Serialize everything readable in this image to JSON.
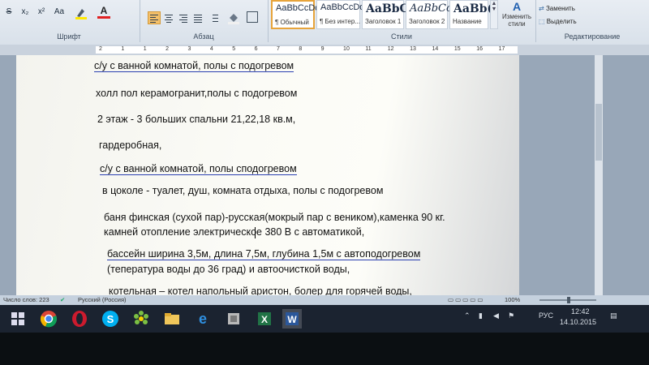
{
  "ribbon": {
    "groups": {
      "font": "Шрифт",
      "paragraph": "Абзац",
      "styles": "Стили",
      "editing": "Редактирование"
    },
    "font_buttons": [
      "S",
      "x₂",
      "x²",
      "Aa",
      "A",
      "A"
    ],
    "styles": [
      {
        "sample": "AaBbCcDd",
        "name": "¶ Обычный"
      },
      {
        "sample": "AaBbCcDd",
        "name": "¶ Без интер..."
      },
      {
        "sample": "AaBbC",
        "name": "Заголовок 1"
      },
      {
        "sample": "AaBbCc",
        "name": "Заголовок 2"
      },
      {
        "sample": "AaBb(",
        "name": "Название"
      }
    ],
    "change_styles_label": "Изменить стили",
    "replace_label": "Заменить",
    "select_label": "Выделить"
  },
  "ruler": {
    "numbers": [
      "2",
      "1",
      "1",
      "2",
      "3",
      "4",
      "5",
      "6",
      "7",
      "8",
      "9",
      "10",
      "11",
      "12",
      "13",
      "14",
      "15",
      "16",
      "17"
    ]
  },
  "document": {
    "lines": [
      "с/у с ванной комнатой, полы с подогревом",
      "холл пол керамогранит,полы  с подогревом",
      "2 этаж - 3 больших спальни 21,22,18 кв.м,",
      "гардеробная,",
      "с/у с ванной комнатой, полы сподогревом",
      "в цоколе - туалет, душ, комната отдыха, полы с подогревом",
      "баня финская  (сухой пар)-русская(мокрый пар с веником),каменка 90 кг.",
      "камней отопление электрическое 380 В с автоматикой,",
      "бассейн ширина 3,5м, длина 7,5м, глубина 1,5м с автоподогревом",
      "(тепература воды до 36 град) и автоочисткой воды,",
      "котельная – котел напольный аристон, болер для горячей воды,"
    ]
  },
  "status": {
    "word_count": "Число слов: 223",
    "language": "Русский (Россия)",
    "zoom": "100%"
  },
  "taskbar": {
    "icons": [
      "windows-start-icon",
      "chrome-icon",
      "opera-icon",
      "skype-icon",
      "icq-icon",
      "file-explorer-icon",
      "edge-icon",
      "app-icon",
      "excel-icon",
      "word-icon"
    ],
    "tray_lang": "РУС",
    "time": "12:42",
    "date": "14.10.2015"
  }
}
